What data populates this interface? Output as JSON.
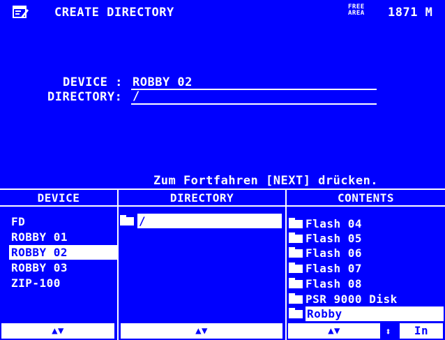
{
  "header": {
    "title": "CREATE DIRECTORY",
    "free_area_line1": "FREE",
    "free_area_line2": "AREA",
    "memory": "1871 M"
  },
  "fields": {
    "device_label": "DEVICE :",
    "device_value": "ROBBY 02",
    "directory_label": "DIRECTORY:",
    "directory_value": "/"
  },
  "hint": "Zum Fortfahren [NEXT] drücken.",
  "columns": {
    "device": "DEVICE",
    "directory": "DIRECTORY",
    "contents": "CONTENTS"
  },
  "devices": [
    "FD",
    "ROBBY 01",
    "ROBBY 02",
    "ROBBY 03",
    "ZIP-100"
  ],
  "selected_device": "ROBBY 02",
  "directory": {
    "current": "/"
  },
  "contents": [
    "Flash 04",
    "Flash 05",
    "Flash 06",
    "Flash 07",
    "Flash 08",
    "PSR 9000 Disk",
    "Robby"
  ],
  "selected_content": "Robby",
  "bottom": {
    "scroll_label": "▲▼",
    "in_label": "In",
    "sort_icon": "sort-arrows-icon"
  },
  "colors": {
    "background": "#0000ff",
    "foreground": "#ffffff"
  }
}
